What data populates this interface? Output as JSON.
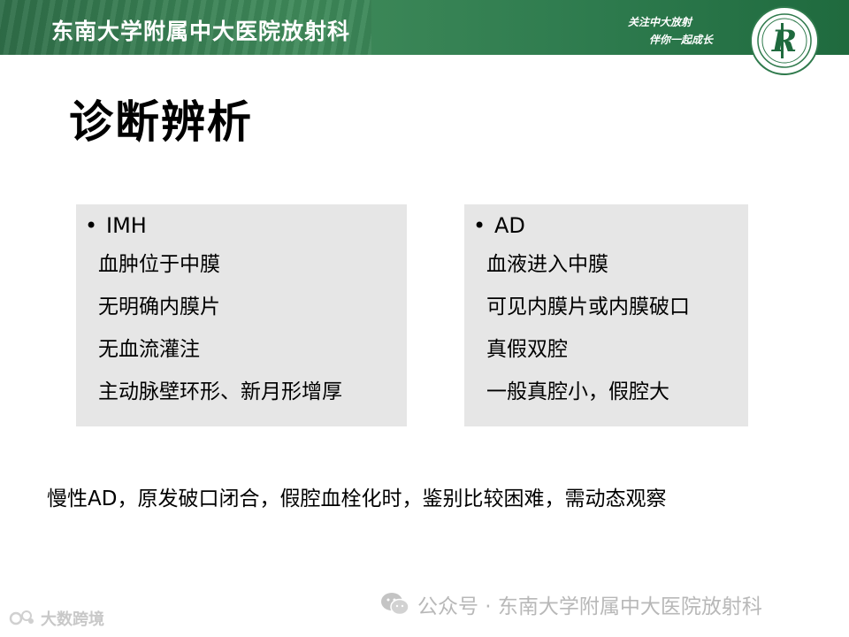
{
  "header": {
    "title": "东南大学附属中大医院放射科",
    "slogan_line1": "关注中大放射",
    "slogan_line2": "伴你一起成长",
    "logo_letter": "R",
    "colors": {
      "green": "#2f7a4c",
      "dark_green": "#1f6a3e"
    }
  },
  "slide": {
    "title": "诊断辨析",
    "left_box": {
      "bullet": "•",
      "heading": "IMH",
      "items": [
        "血肿位于中膜",
        "无明确内膜片",
        "无血流灌注",
        "主动脉壁环形、新月形增厚"
      ]
    },
    "right_box": {
      "bullet": "•",
      "heading": "AD",
      "items": [
        "血液进入中膜",
        "可见内膜片或内膜破口",
        "真假双腔",
        "一般真腔小，假腔大"
      ]
    },
    "note": "慢性AD，原发破口闭合，假腔血栓化时，鉴别比较困难，需动态观察"
  },
  "watermarks": {
    "wechat_text": "公众号 · 东南大学附属中大医院放射科",
    "corner_text": "大数跨境"
  }
}
